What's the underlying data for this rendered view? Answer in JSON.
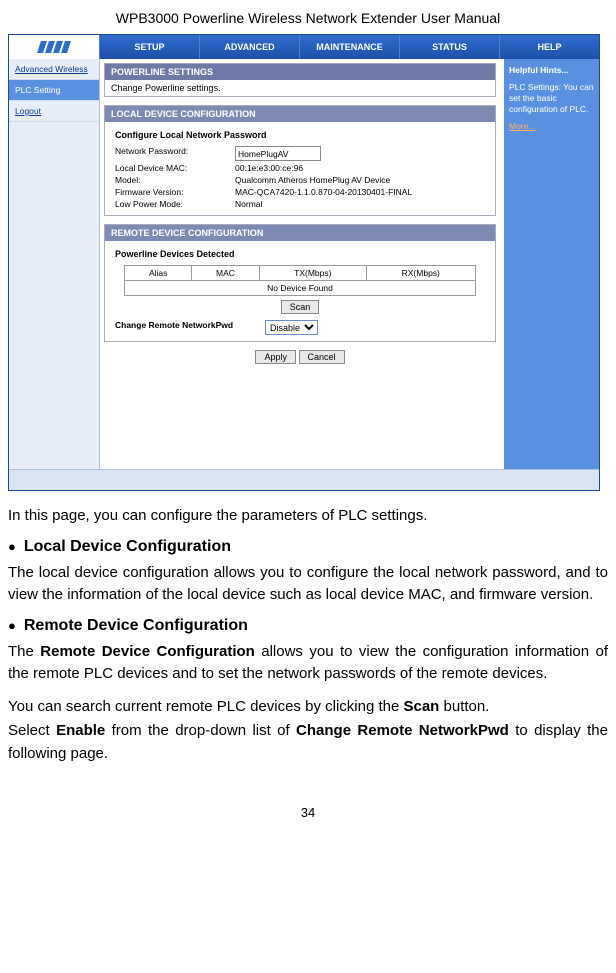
{
  "doc": {
    "header_pre": "WPB3000 ",
    "header_mid": "Powerline Wireless Network Extender ",
    "header_post": "User Manual",
    "page_num": "34"
  },
  "nav": {
    "tabs": [
      "SETUP",
      "ADVANCED",
      "MAINTENANCE",
      "STATUS",
      "HELP"
    ]
  },
  "sidebar": {
    "items": [
      "Advanced Wireless",
      "PLC Setting",
      "Logout"
    ]
  },
  "help": {
    "title": "Helpful Hints...",
    "body": "PLC Settings: You can set the basic configuration of PLC.",
    "more": "More..."
  },
  "panel_main": {
    "title": "POWERLINE SETTINGS",
    "desc": "Change Powerline settings."
  },
  "panel_local": {
    "title": "LOCAL DEVICE CONFIGURATION",
    "subhd": "Configure Local Network Password",
    "rows": {
      "k1": "Network Password:",
      "v1": "HomePlugAV",
      "k2": "Local Device MAC:",
      "v2": "00:1e:e3:00:ce:96",
      "k3": "Model:",
      "v3": "Qualcomm Atheros HomePlug AV Device",
      "k4": "Firmware Version:",
      "v4": "MAC-QCA7420-1.1.0.870-04-20130401-FINAL",
      "k5": "Low Power Mode:",
      "v5": "Normal"
    }
  },
  "panel_remote": {
    "title": "REMOTE DEVICE CONFIGURATION",
    "subhd": "Powerline Devices Detected",
    "cols": [
      "Alias",
      "MAC",
      "TX(Mbps)",
      "RX(Mbps)"
    ],
    "empty": "No Device Found",
    "scan": "Scan",
    "change_label": "Change Remote NetworkPwd",
    "change_value": "Disable"
  },
  "actions": {
    "apply": "Apply",
    "cancel": "Cancel"
  },
  "text": {
    "p1": "In this page, you can configure the parameters of PLC settings.",
    "h1": "Local Device Configuration",
    "p2": "The local device configuration allows you to configure the local network password, and to view the information of the local device such as local device MAC, and firmware version.",
    "h2": "Remote Device Configuration",
    "p3a": "The ",
    "p3b": "Remote Device Configuration",
    "p3c": " allows you to view the configuration information of the remote PLC devices and to set the network passwords of the remote devices.",
    "p4a": "You can search current remote PLC devices by clicking the ",
    "p4b": "Scan",
    "p4c": " button.",
    "p5a": "Select ",
    "p5b": "Enable",
    "p5c": " from the drop-down list of ",
    "p5d": "Change Remote NetworkPwd",
    "p5e": " to display the following page."
  }
}
